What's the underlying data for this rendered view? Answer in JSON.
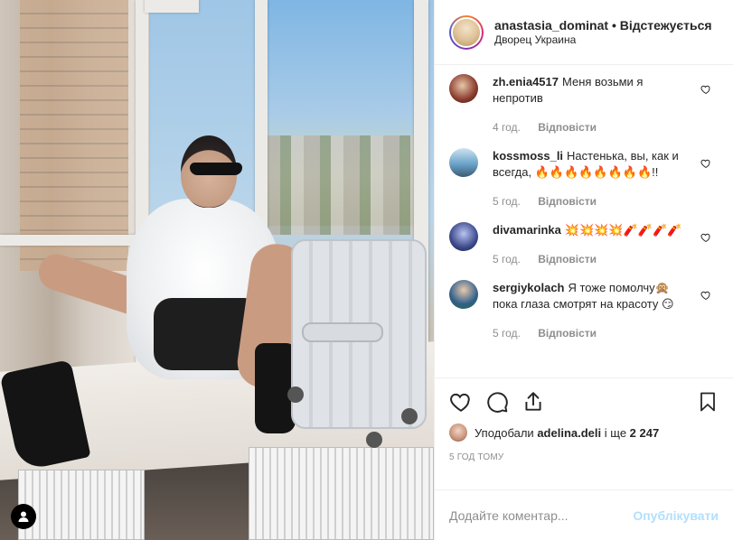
{
  "post": {
    "username": "anastasia_dominat",
    "separator": "•",
    "follow_status": "Відстежується",
    "location": "Дворец Украина"
  },
  "comments": [
    {
      "username": "zh.enia4517",
      "text": "Меня возьми я непротив",
      "time": "4 год.",
      "reply": "Відповісти",
      "avatar_color": "#8a3b2e"
    },
    {
      "username": "kossmoss_li",
      "text": "Настенька, вы, как и всегда, 🔥🔥🔥🔥🔥🔥🔥🔥!!",
      "time": "5 год.",
      "reply": "Відповісти",
      "avatar_color": "#6aa3c9"
    },
    {
      "username": "divamarinka",
      "text": "💥💥💥💥🧨🧨🧨🧨",
      "time": "5 год.",
      "reply": "Відповісти",
      "avatar_color": "#3e4b8c"
    },
    {
      "username": "sergiykolach",
      "text": "Я тоже помолчу🙊 пока глаза смотрят на красоту 😏",
      "time": "5 год.",
      "reply": "Відповісти",
      "avatar_color": "#2f5f8a"
    }
  ],
  "likes": {
    "prefix": "Уподобали",
    "user": "adelina.deli",
    "connector": "і ще",
    "count": "2 247"
  },
  "timestamp": "5 ГОД ТОМУ",
  "add_comment": {
    "placeholder": "Додайте коментар...",
    "publish": "Опублікувати"
  },
  "icons": {
    "like": "heart-icon",
    "comment": "comment-icon",
    "share": "share-icon",
    "save": "bookmark-icon",
    "tag": "user-tag-icon"
  },
  "colors": {
    "text": "#262626",
    "muted": "#8e8e8e",
    "publish_disabled": "#b2dffc"
  }
}
